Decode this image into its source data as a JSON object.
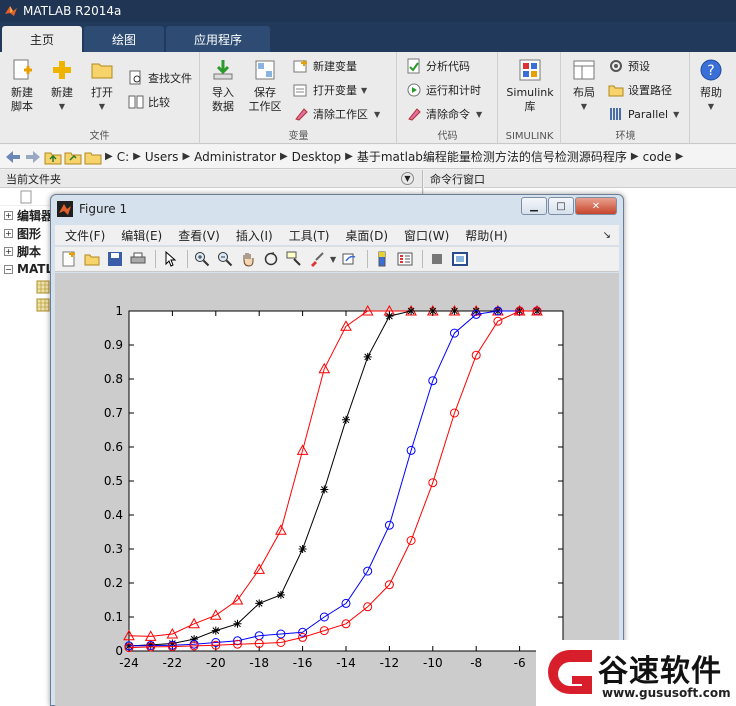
{
  "window": {
    "title": "MATLAB R2014a"
  },
  "tabs": [
    {
      "label": "主页",
      "active": true
    },
    {
      "label": "绘图",
      "active": false
    },
    {
      "label": "应用程序",
      "active": false
    }
  ],
  "ribbon": {
    "file": {
      "label": "文件",
      "new_script": "新建\n脚本",
      "new": "新建",
      "open": "打开",
      "find_files": "查找文件",
      "compare": "比较"
    },
    "variable": {
      "label": "变量",
      "import": "导入\n数据",
      "save_ws": "保存\n工作区",
      "new_var": "新建变量",
      "open_var": "打开变量",
      "clear_ws": "清除工作区"
    },
    "code": {
      "label": "代码",
      "analyze": "分析代码",
      "run_time": "运行和计时",
      "clear_cmd": "清除命令"
    },
    "simulink": {
      "label": "SIMULINK",
      "lib": "Simulink\n库"
    },
    "environment": {
      "label": "环境",
      "layout": "布局",
      "prefs": "预设",
      "set_path": "设置路径",
      "parallel": "Parallel"
    },
    "resources": {
      "help": "帮助"
    }
  },
  "address": {
    "crumbs": [
      "C:",
      "Users",
      "Administrator",
      "Desktop",
      "基于matlab编程能量检测方法的信号检测源码程序",
      "code"
    ]
  },
  "left_panel": {
    "title": "当前文件夹",
    "items": [
      {
        "box": "+",
        "label": "编辑器"
      },
      {
        "box": "+",
        "label": "图形"
      },
      {
        "box": "+",
        "label": "脚本"
      },
      {
        "box": "−",
        "label": "MATL"
      }
    ]
  },
  "right_panel": {
    "title": "命令行窗口"
  },
  "figure": {
    "title": "Figure 1",
    "menu": [
      "文件(F)",
      "编辑(E)",
      "查看(V)",
      "插入(I)",
      "工具(T)",
      "桌面(D)",
      "窗口(W)",
      "帮助(H)"
    ]
  },
  "chart_data": {
    "type": "line",
    "xlim": [
      -24,
      -4
    ],
    "ylim": [
      0,
      1
    ],
    "xticks": [
      "-24",
      "-22",
      "-20",
      "-18",
      "-16",
      "-14",
      "-12",
      "-10",
      "-8",
      "-6"
    ],
    "yticks": [
      "0",
      "0.1",
      "0.2",
      "0.3",
      "0.4",
      "0.5",
      "0.6",
      "0.7",
      "0.8",
      "0.9",
      "1"
    ],
    "grid": false,
    "series": [
      {
        "color": "#ff0000",
        "marker": "triangle",
        "x": [
          -24,
          -23,
          -22,
          -21,
          -20,
          -19,
          -18,
          -17,
          -16,
          -15,
          -14,
          -13,
          -12,
          -11,
          -10,
          -9,
          -8,
          -7,
          -6,
          -5.2
        ],
        "y": [
          0.045,
          0.043,
          0.05,
          0.08,
          0.105,
          0.15,
          0.24,
          0.355,
          0.59,
          0.83,
          0.955,
          1.0,
          1.0,
          1.0,
          1.0,
          1.0,
          1.0,
          1.0,
          1.0,
          1.0
        ]
      },
      {
        "color": "#000000",
        "marker": "star",
        "x": [
          -24,
          -23,
          -22,
          -21,
          -20,
          -19,
          -18,
          -17,
          -16,
          -15,
          -14,
          -13,
          -12,
          -11,
          -10,
          -9,
          -8,
          -7,
          -6,
          -5.2
        ],
        "y": [
          0.015,
          0.018,
          0.022,
          0.035,
          0.06,
          0.08,
          0.14,
          0.165,
          0.3,
          0.475,
          0.68,
          0.865,
          0.985,
          1.0,
          1.0,
          1.0,
          1.0,
          1.0,
          1.0,
          1.0
        ]
      },
      {
        "color": "#0000ff",
        "marker": "circle",
        "x": [
          -24,
          -23,
          -22,
          -21,
          -20,
          -19,
          -18,
          -17,
          -16,
          -15,
          -14,
          -13,
          -12,
          -11,
          -10,
          -9,
          -8,
          -7,
          -6,
          -5.2
        ],
        "y": [
          0.015,
          0.016,
          0.017,
          0.02,
          0.025,
          0.03,
          0.045,
          0.05,
          0.055,
          0.1,
          0.14,
          0.235,
          0.37,
          0.59,
          0.795,
          0.935,
          0.99,
          1.0,
          1.0,
          1.0
        ]
      },
      {
        "color": "#ff0000",
        "marker": "circle",
        "x": [
          -24,
          -23,
          -22,
          -21,
          -20,
          -19,
          -18,
          -17,
          -16,
          -15,
          -14,
          -13,
          -12,
          -11,
          -10,
          -9,
          -8,
          -7,
          -6,
          -5.2
        ],
        "y": [
          0.01,
          0.012,
          0.013,
          0.015,
          0.017,
          0.02,
          0.022,
          0.025,
          0.04,
          0.06,
          0.08,
          0.13,
          0.195,
          0.325,
          0.495,
          0.7,
          0.87,
          0.97,
          1.0,
          1.0
        ]
      }
    ]
  },
  "watermark": {
    "text": "谷速软件",
    "url": "www.gususoft.com"
  }
}
